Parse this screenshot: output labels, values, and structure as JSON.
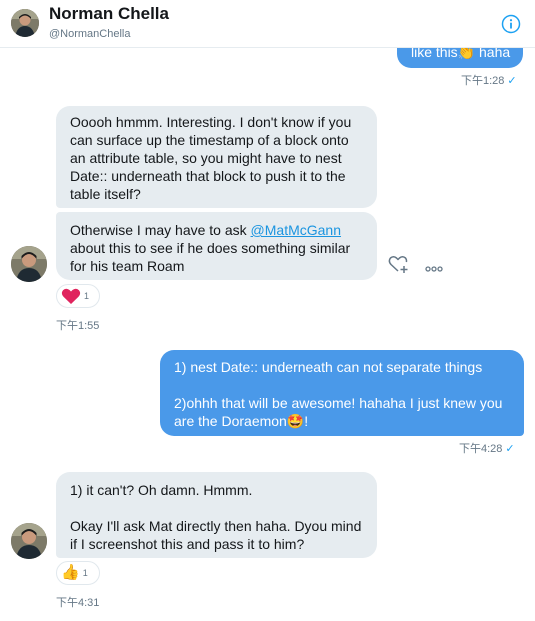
{
  "header": {
    "name": "Norman Chella",
    "handle": "@NormanChella"
  },
  "messages": {
    "m1": {
      "text_a": "like this",
      "emoji": "👏",
      "text_b": " haha",
      "time": "下午1:28",
      "check": "✓"
    },
    "m2": {
      "lines": [
        "Ooooh hmmm. Interesting. I don't know if you",
        "can surface up the timestamp of a block onto",
        "an attribute table, so you might have to nest",
        "Date:: underneath that block to push it to the",
        "table itself?"
      ]
    },
    "m3": {
      "l1_a": "Otherwise I may have to ask ",
      "mention": "@MatMcGann",
      "l2": "about this to see if he does something similar",
      "l3": "for his team Roam",
      "reaction_emoji": "heart",
      "reaction_count": "1",
      "time": "下午1:55"
    },
    "m4": {
      "l1": "1) nest Date:: underneath can not separate things",
      "l2": "2)ohhh that will be awesome! hahaha I just knew you",
      "l3_a": "are the Doraemon",
      "emoji": "🤩",
      "l3_b": "!",
      "time": "下午4:28",
      "check": "✓"
    },
    "m5": {
      "l1": "1) it can't? Oh damn. Hmmm.",
      "l2": "Okay I'll ask Mat directly then haha. Dyou mind",
      "l3": "if I screenshot this and pass it to him?",
      "reaction_emoji": "👍",
      "reaction_count": "1",
      "time": "下午4:31"
    }
  },
  "colors": {
    "outgoing_bubble": "#4a99e9",
    "incoming_bubble": "#e6ecf0",
    "accent": "#1da1f2",
    "heart": "#e0245e"
  }
}
